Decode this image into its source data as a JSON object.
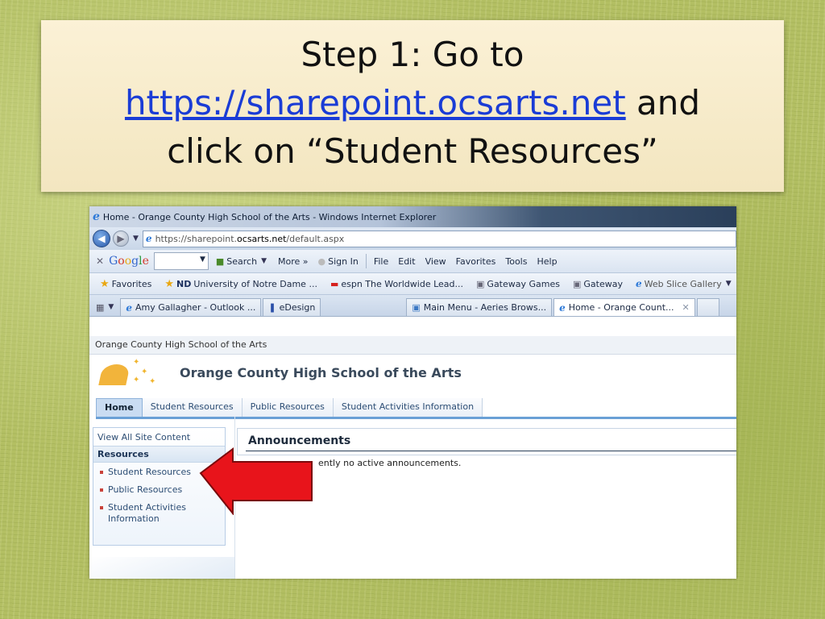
{
  "slide": {
    "title_before": "Step 1: Go to",
    "title_link": "https://sharepoint.ocsarts.net",
    "title_after": " and",
    "title_line3": "click on “Student Resources”"
  },
  "browser": {
    "window_title": "Home - Orange County High School of the Arts - Windows Internet Explorer",
    "address_prefix": "https://sharepoint.",
    "address_site": "ocsarts.net",
    "address_suffix": "/default.aspx",
    "google_logo": "Google",
    "google_search_label": "Search",
    "google_more_label": "More »",
    "google_signin_label": "Sign In",
    "menu": [
      "File",
      "Edit",
      "View",
      "Favorites",
      "Tools",
      "Help"
    ],
    "favorites_label": "Favorites",
    "favorites": [
      "University of Notre Dame ...",
      "espn The Worldwide Lead...",
      "Gateway Games",
      "Gateway",
      "Web Slice Gallery"
    ],
    "tabs": [
      "Amy Gallagher - Outlook ...",
      "eDesign",
      "Main Menu - Aeries Brows...",
      "Home - Orange Count..."
    ]
  },
  "site": {
    "breadcrumb": "Orange County High School of the Arts",
    "title": "Orange County High School of the Arts",
    "nav": [
      "Home",
      "Student Resources",
      "Public Resources",
      "Student Activities Information"
    ],
    "view_all": "View All Site Content",
    "resources_heading": "Resources",
    "resources": [
      "Student Resources",
      "Public Resources",
      "Student Activities Information"
    ],
    "announcements_title": "Announcements",
    "announcements_text": "ently no active announcements."
  },
  "colors": {
    "arrow": "#e8141b",
    "link": "#1a3cd6"
  },
  "icons": {
    "ie": "ie-logo-icon",
    "back": "back-arrow-icon",
    "forward": "forward-arrow-icon",
    "favorites": "star-icon",
    "close_tab": "close-icon",
    "pointer": "red-arrow-icon"
  }
}
